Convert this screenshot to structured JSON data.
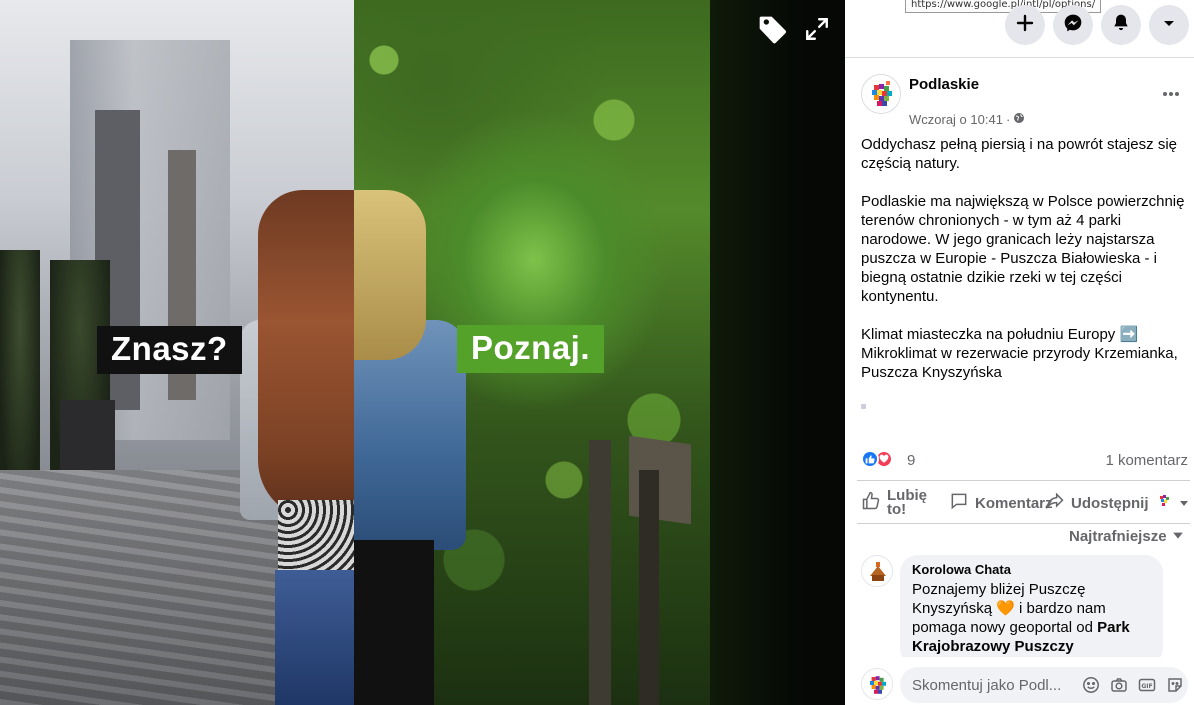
{
  "photo": {
    "left_label": "Znasz?",
    "right_label": "Poznaj.",
    "tag_icon": "tag-icon",
    "expand_icon": "expand-icon",
    "colors": {
      "left_label_bg": "#111111",
      "right_label_bg": "#55a22b"
    }
  },
  "browser": {
    "url_tooltip": "https://www.google.pl/intl/pl/options/"
  },
  "topbar": {
    "buttons": [
      "plus-icon",
      "messenger-icon",
      "bell-icon",
      "caret-down-icon"
    ]
  },
  "post": {
    "page_name": "Podlaskie",
    "time": "Wczoraj o 10:41",
    "visibility_icon": "globe-icon",
    "paragraphs": [
      "Oddychasz pełną piersią i na powrót stajesz się częścią natury.",
      "Podlaskie ma największą w Polsce powierzchnię terenów chronionych - w tym aż 4 parki narodowe. W jego granicach leży najstarsza puszcza w Europie - Puszcza Białowieska - i biegną ostatnie dzikie rzeki w tej części kontynentu.",
      "Klimat miasteczka na południu Europy ➡️ Mikroklimat w rezerwacie przyrody Krzemianka, Puszcza Knyszyńska"
    ],
    "reaction_count": "9",
    "comment_count": "1 komentarz"
  },
  "actions": {
    "like": "Lubię to!",
    "comment": "Komentarz",
    "share": "Udostępnij"
  },
  "comments": {
    "sort_label": "Najtrafniejsze",
    "items": [
      {
        "author": "Korolowa Chata",
        "text_before": "Poznajemy bliżej Puszczę Knyszyńską ",
        "emoji": "🧡",
        "text_after": " i bardzo nam pomaga nowy geoportal od ",
        "bold": "Park Krajobrazowy Puszczy"
      }
    ]
  },
  "composer": {
    "placeholder": "Skomentuj jako Podl..."
  },
  "colors": {
    "accent": "#1877f2",
    "love": "#f33e58",
    "muted_text": "#65676b",
    "bubble_bg": "#f0f2f5"
  }
}
